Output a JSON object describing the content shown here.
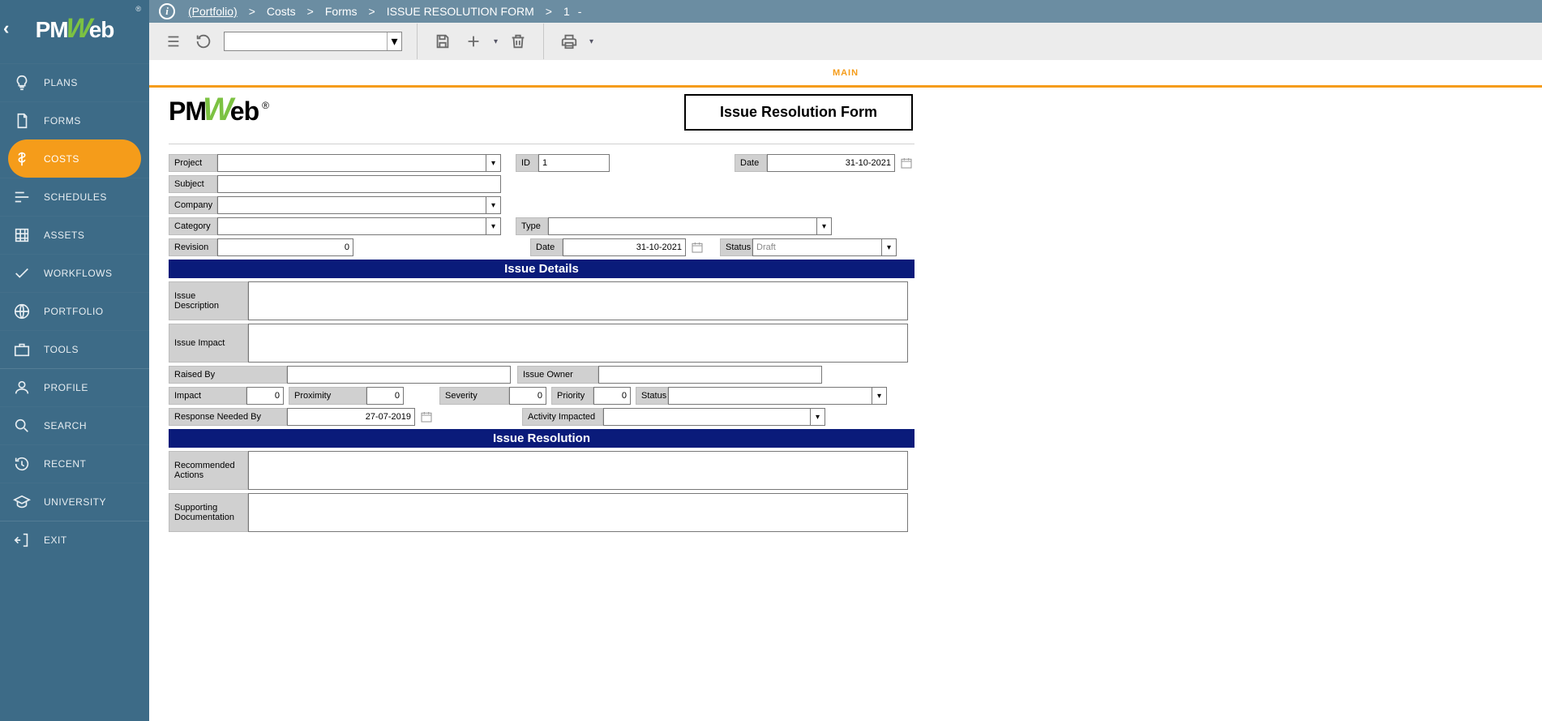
{
  "logo": {
    "reg": "®"
  },
  "sidebar": {
    "items": [
      {
        "label": "PLANS",
        "icon": "bulb"
      },
      {
        "label": "FORMS",
        "icon": "doc"
      },
      {
        "label": "COSTS",
        "icon": "dollar",
        "active": true
      },
      {
        "label": "SCHEDULES",
        "icon": "bars"
      },
      {
        "label": "ASSETS",
        "icon": "grid"
      },
      {
        "label": "WORKFLOWS",
        "icon": "check"
      },
      {
        "label": "PORTFOLIO",
        "icon": "globe"
      },
      {
        "label": "TOOLS",
        "icon": "briefcase"
      },
      {
        "label": "PROFILE",
        "icon": "person",
        "sep": true
      },
      {
        "label": "SEARCH",
        "icon": "search"
      },
      {
        "label": "RECENT",
        "icon": "history"
      },
      {
        "label": "UNIVERSITY",
        "icon": "cap"
      },
      {
        "label": "EXIT",
        "icon": "exit",
        "sep": true
      }
    ]
  },
  "breadcrumb": {
    "portfolio": "(Portfolio)",
    "sep": ">",
    "costs": "Costs",
    "forms": "Forms",
    "form_name": "ISSUE RESOLUTION FORM",
    "id": "1",
    "dash": "-"
  },
  "toolbar": {
    "select_value": ""
  },
  "tab": {
    "main": "MAIN"
  },
  "form": {
    "title": "Issue Resolution Form",
    "labels": {
      "project": "Project",
      "id": "ID",
      "date": "Date",
      "subject": "Subject",
      "company": "Company",
      "category": "Category",
      "type": "Type",
      "revision": "Revision",
      "status": "Status",
      "date2": "Date",
      "section_details": "Issue Details",
      "issue_desc": "Issue Description",
      "issue_impact": "Issue Impact",
      "raised_by": "Raised By",
      "issue_owner": "Issue Owner",
      "impact": "Impact",
      "proximity": "Proximity",
      "severity": "Severity",
      "priority": "Priority",
      "status2": "Status",
      "resp_needed": "Response Needed By",
      "activity_impacted": "Activity Impacted",
      "section_resolution": "Issue Resolution",
      "rec_actions": "Recommended Actions",
      "supporting_doc": "Supporting Documentation"
    },
    "values": {
      "project": "",
      "id": "1",
      "date": "31-10-2021",
      "subject": "",
      "company": "",
      "category": "",
      "type": "",
      "revision": "0",
      "rev_date": "31-10-2021",
      "status": "Draft",
      "issue_desc": "",
      "issue_impact": "",
      "raised_by": "",
      "issue_owner": "",
      "impact": "0",
      "proximity": "0",
      "severity": "0",
      "priority": "0",
      "status2": "",
      "resp_needed": "27-07-2019",
      "activity_impacted": "",
      "rec_actions": "",
      "supporting_doc": ""
    }
  }
}
